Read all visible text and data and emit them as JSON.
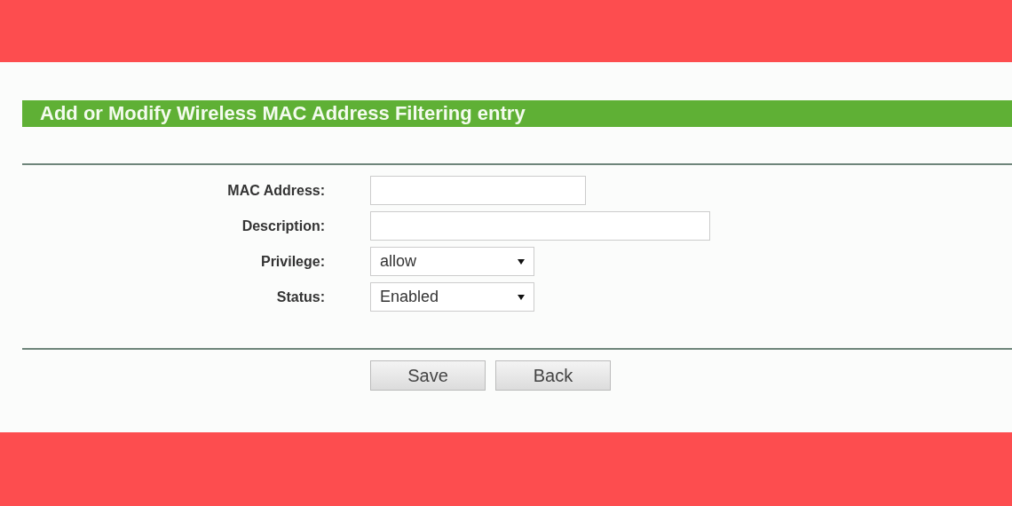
{
  "title": "Add or Modify Wireless MAC Address Filtering entry",
  "fields": [
    {
      "label": "MAC Address:",
      "kind": "text"
    },
    {
      "label": "Description:",
      "kind": "text"
    },
    {
      "label": "Privilege:",
      "kind": "select",
      "value": "allow"
    },
    {
      "label": "Status:",
      "kind": "select",
      "value": "Enabled"
    }
  ],
  "buttons": [
    "Save",
    "Back"
  ]
}
